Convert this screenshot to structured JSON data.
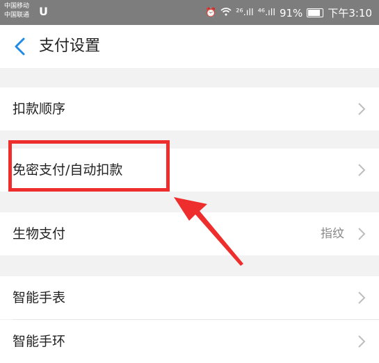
{
  "status_bar": {
    "carrier_1": "中国移动",
    "carrier_2": "中国联通",
    "app_glyph": "U",
    "network_1": "²⁶.ıll",
    "network_2": "⁴⁶.ıll",
    "battery": "91%",
    "time": "下午3:10",
    "icons": [
      "alarm-icon",
      "wifi-icon",
      "signal-icon",
      "battery-icon"
    ]
  },
  "nav": {
    "title": "支付设置",
    "back_icon": "chevron-left-icon"
  },
  "settings": {
    "items": [
      {
        "label": "扣款顺序",
        "value": ""
      },
      {
        "label": "免密支付/自动扣款",
        "value": ""
      },
      {
        "label": "生物支付",
        "value": "指纹"
      },
      {
        "label": "智能手表",
        "value": ""
      },
      {
        "label": "智能手环",
        "value": ""
      }
    ]
  },
  "annotation": {
    "highlight_color": "#ee2d2d"
  },
  "colors": {
    "accent": "#1e8ce6",
    "background": "#f2f2f2",
    "status_bar": "#7d7d7d"
  }
}
